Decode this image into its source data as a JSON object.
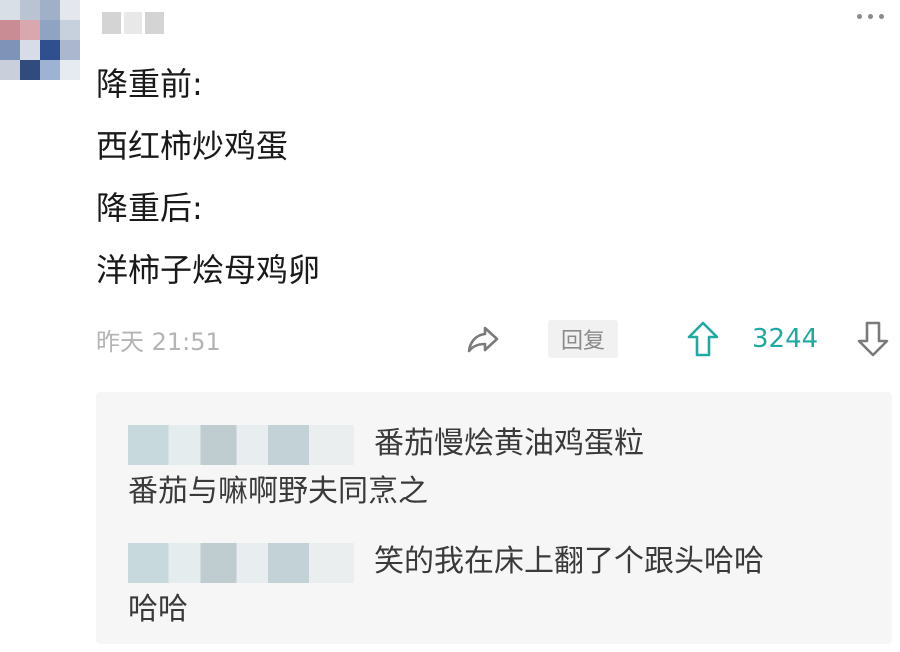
{
  "post": {
    "lines": [
      "降重前:",
      "西红柿炒鸡蛋",
      "降重后:",
      "洋柿子烩母鸡卵"
    ],
    "timestamp": "昨天 21:51",
    "reply_label": "回复",
    "vote_count": "3244"
  },
  "replies": [
    {
      "text_line_1": "番茄慢烩黄油鸡蛋粒",
      "text_line_2": "番茄与嘛啊野夫同烹之"
    },
    {
      "text_line_1": "笑的我在床上翻了个跟头哈哈",
      "text_line_2": "哈哈"
    }
  ],
  "icons": {
    "more": "more-dots-icon",
    "share": "share-arrow-icon",
    "upvote": "upvote-arrow-icon",
    "downvote": "downvote-arrow-icon"
  },
  "colors": {
    "accent": "#1fa9a3",
    "muted_text": "#b4b4b4",
    "reply_background": "#f6f6f6"
  }
}
